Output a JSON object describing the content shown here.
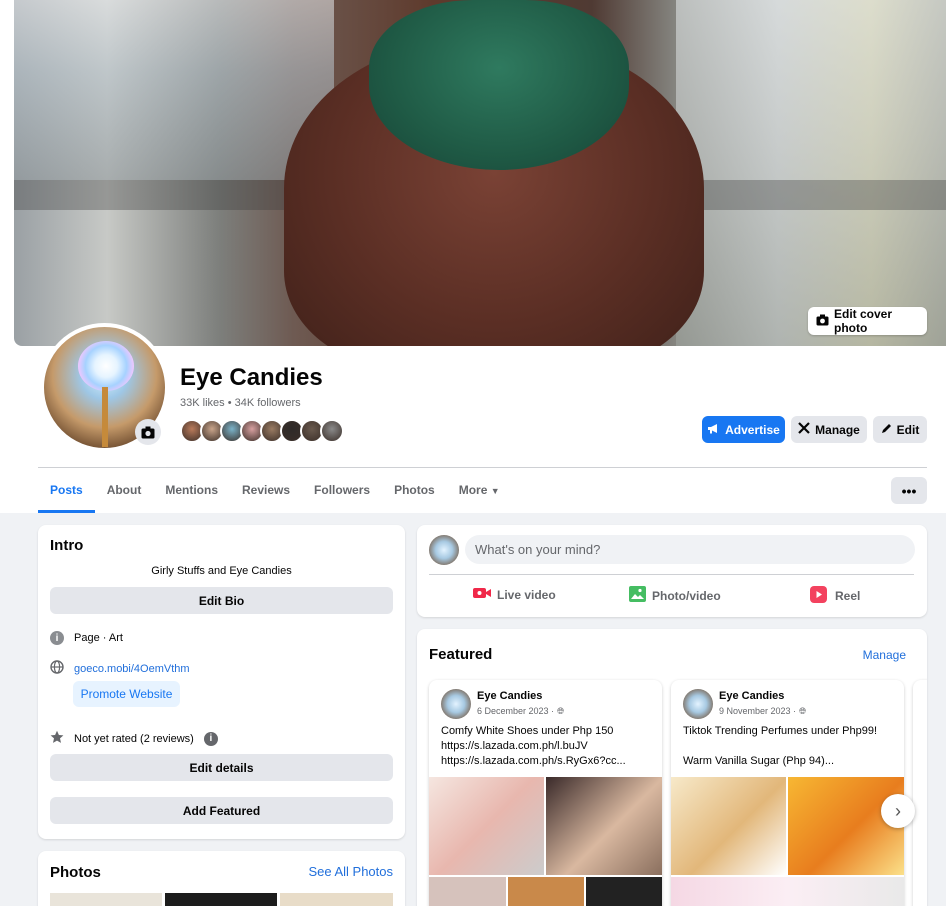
{
  "cover": {
    "edit_label": "Edit cover photo"
  },
  "page": {
    "name": "Eye Candies",
    "stats": "33K likes • 34K followers",
    "face_colors": [
      "#b97a5a",
      "#c9a48a",
      "#7ab3c9",
      "#d8a0a0",
      "#9a7b62",
      "#2e2a28",
      "#6a5a4e",
      "#8a8a8a"
    ]
  },
  "actions": {
    "advertise": "Advertise",
    "manage": "Manage",
    "edit": "Edit"
  },
  "tabs": [
    "Posts",
    "About",
    "Mentions",
    "Reviews",
    "Followers",
    "Photos",
    "More"
  ],
  "more_menu": "•••",
  "intro": {
    "title": "Intro",
    "bio": "Girly Stuffs and Eye Candies",
    "edit_bio": "Edit Bio",
    "category": "Page · Art",
    "website": "goeco.mobi/4OemVthm",
    "promote": "Promote Website",
    "rating": "Not yet rated (2 reviews)",
    "edit_details": "Edit details",
    "add_featured": "Add Featured"
  },
  "photos": {
    "title": "Photos",
    "see_all": "See All Photos"
  },
  "composer": {
    "placeholder": "What's on your mind?",
    "live": "Live video",
    "photo": "Photo/video",
    "reel": "Reel"
  },
  "featured": {
    "title": "Featured",
    "manage": "Manage",
    "posts": [
      {
        "author": "Eye Candies",
        "date": "6 December 2023 ·",
        "line1": "Comfy White Shoes under Php 150",
        "line2": "https://s.lazada.com.ph/l.buJV",
        "line3": "https://s.lazada.com.ph/s.RyGx6?cc..."
      },
      {
        "author": "Eye Candies",
        "date": "9 November 2023 ·",
        "line1": "Tiktok Trending Perfumes under Php99!",
        "line2": "",
        "line3": "Warm Vanilla Sugar (Php 94)..."
      }
    ]
  },
  "colors": {
    "accent": "#1877f2",
    "bg": "#f0f2f5"
  }
}
